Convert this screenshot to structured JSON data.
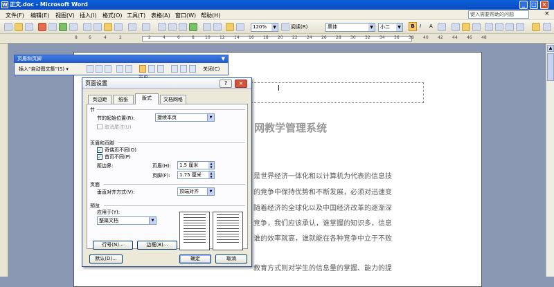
{
  "window": {
    "title": "正文.doc - Microsoft Word",
    "minimize": "_",
    "maximize": "□",
    "close": "×"
  },
  "menubar": {
    "items": [
      "文件(F)",
      "编辑(E)",
      "视图(V)",
      "插入(I)",
      "格式(O)",
      "工具(T)",
      "表格(A)",
      "窗口(W)",
      "帮助(H)"
    ],
    "help_placeholder": "键入需要帮助的问题",
    "close": "×"
  },
  "toolbar": {
    "zoom": "120%",
    "read_mode": "阅读(R)",
    "font": "黑体",
    "size": "小二",
    "bold": "B",
    "italic": "I",
    "char_scale": "A"
  },
  "ruler": {
    "numbers": [
      "8",
      "6",
      "4",
      "2",
      "2",
      "4",
      "6",
      "8",
      "10",
      "12",
      "14",
      "16",
      "18",
      "20",
      "22",
      "24",
      "26",
      "28",
      "30",
      "32",
      "34",
      "36",
      "38",
      "40",
      "42",
      "44",
      "46",
      "48"
    ]
  },
  "hf_toolbar": {
    "title": "页眉和页脚",
    "insert_autotext": "插入“自动图文集”(S) ▾",
    "close": "关闭(C)"
  },
  "document": {
    "header_label": "页眉",
    "heading": "网教学管理系统",
    "lines": [
      "是世界经济一体化和以计算机为代表的信息技",
      "的竞争中保持优势和不断发展，必须对迅速变",
      "随着经济的全球化以及中国经济改革的逐渐深",
      "竞争，我们应该承认，谁掌握的知识多，信息",
      "谁的效率就高，谁就能在各种竞争中立于不败",
      "教育方式则对学生的信息量的掌握、能力的提"
    ]
  },
  "dialog": {
    "title": "页面设置",
    "help": "?",
    "close": "×",
    "tabs": [
      "页边距",
      "纸张",
      "版式",
      "文档网格"
    ],
    "active_tab": "版式",
    "section": {
      "label": "节",
      "start_label": "节的起始位置(R):",
      "start_value": "接续本页",
      "cancel_endnotes": "取消尾注(U)"
    },
    "headers_footers": {
      "label": "页眉和页脚",
      "odd_even": "奇偶页不同(O)",
      "odd_even_checked": true,
      "first_page": "首页不同(P)",
      "first_page_checked": true,
      "from_edge": "距边界:",
      "header_label": "页眉(H):",
      "header_value": "1.5 厘米",
      "footer_label": "页脚(F):",
      "footer_value": "1.75 厘米"
    },
    "page": {
      "label": "页面",
      "valign_label": "垂直对齐方式(V):",
      "valign_value": "顶端对齐"
    },
    "preview": {
      "label": "预览",
      "apply_label": "应用于(Y):",
      "apply_value": "整篇文档"
    },
    "buttons": {
      "line_numbers": "行号(N)...",
      "borders": "边框(B)...",
      "default": "默认(D)...",
      "ok": "确定",
      "cancel": "取消"
    }
  }
}
